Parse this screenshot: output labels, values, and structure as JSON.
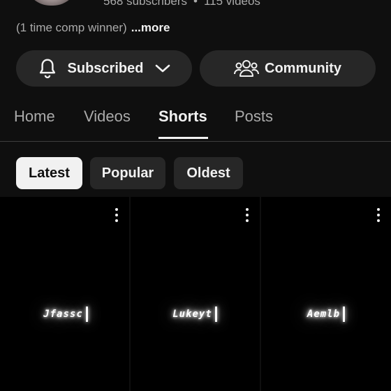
{
  "channel": {
    "subscribers": "568 subscribers",
    "separator": "•",
    "videos": "115 videos",
    "description": "(1 time comp winner)",
    "more_label": "...more"
  },
  "actions": {
    "subscribed_label": "Subscribed",
    "community_label": "Community"
  },
  "tabs": [
    {
      "label": "Home",
      "active": false
    },
    {
      "label": "Videos",
      "active": false
    },
    {
      "label": "Shorts",
      "active": true
    },
    {
      "label": "Posts",
      "active": false
    }
  ],
  "filters": [
    {
      "label": "Latest",
      "selected": true
    },
    {
      "label": "Popular",
      "selected": false
    },
    {
      "label": "Oldest",
      "selected": false
    }
  ],
  "shorts": [
    {
      "text": "Jfassc"
    },
    {
      "text": "Lukeyt"
    },
    {
      "text": "Aemlb"
    }
  ],
  "icons": {
    "bell": "bell-icon",
    "chevron": "chevron-down-icon",
    "community": "community-icon",
    "more": "more-vert-icon"
  },
  "colors": {
    "background": "#0f0f0f",
    "surface": "#272727",
    "text_primary": "#f1f1f1",
    "text_secondary": "#aaaaaa"
  }
}
